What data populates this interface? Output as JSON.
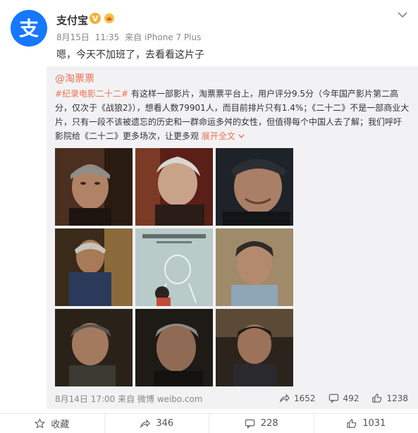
{
  "post": {
    "author": "支付宝",
    "verified_mark": "V",
    "date": "8月15日",
    "time": "11:35",
    "source_prefix": "来自",
    "source": "iPhone 7 Plus",
    "text": "嗯，今天不加班了，去看看这片子"
  },
  "repost": {
    "author": "@淘票票",
    "hashtag": "#纪录电影二十二#",
    "body": "有这样一部影片，淘票票平台上，用户评分9.5分（今年国产影片第二高分，仅次于《战狼2》），想看人数79901人，而目前排片只有1.4%；《二十二》不是一部商业大片，只有一段不该被遗忘的历史和一群命运多舛的女性，但值得每个中国人去了解；我们呼吁影院给《二十二》更多场次，让更多观",
    "expand_label": "展开全文",
    "expand_icon": "chevron-down-icon",
    "footer": "8月14日 17:00 来自 微博 weibo.com",
    "stats": {
      "reposts": "1652",
      "comments": "492",
      "likes": "1238"
    }
  },
  "actions": {
    "favorite": "收藏",
    "repost": "346",
    "comment": "228",
    "like": "1031"
  },
  "colors": {
    "brand_blue": "#1677ff",
    "link_orange": "#eb7350",
    "repost_bg": "#f2f2f5"
  }
}
